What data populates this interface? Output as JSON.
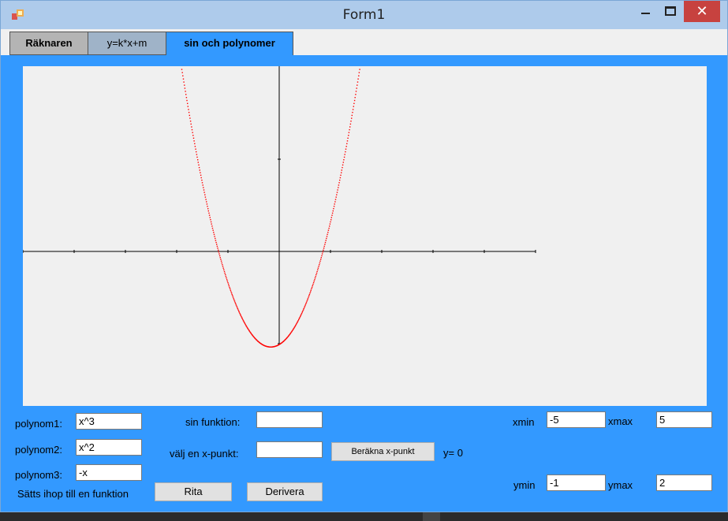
{
  "window": {
    "title": "Form1"
  },
  "titlebar": {
    "close_glyph": "✕"
  },
  "tabs": [
    {
      "label": "Räknaren"
    },
    {
      "label": "y=k*x+m"
    },
    {
      "label": "sin och polynomer"
    }
  ],
  "form": {
    "polynom1_label": "polynom1:",
    "polynom1_value": "x^3",
    "polynom2_label": "polynom2:",
    "polynom2_value": "x^2",
    "polynom3_label": "polynom3:",
    "polynom3_value": "-x",
    "combine_note": "Sätts ihop till en funktion",
    "sin_label": "sin funktion:",
    "sin_value": "",
    "xpoint_label": "välj en x-punkt:",
    "xpoint_value": "",
    "compute_button": "Beräkna x-punkt",
    "result_text": "y= 0",
    "rita_button": "Rita",
    "derivera_button": "Derivera",
    "xmin_label": "xmin",
    "xmin_value": "-5",
    "xmax_label": "xmax",
    "xmax_value": "5",
    "ymin_label": "ymin",
    "ymin_value": "-1",
    "ymax_label": "ymax",
    "ymax_value": "2"
  },
  "plot": {
    "curve_color": "#ff0000",
    "axis_color": "#000000"
  },
  "colors": {
    "form_background": "#3399ff",
    "titlebar": "#aecbeb",
    "close_button": "#c7423f"
  }
}
